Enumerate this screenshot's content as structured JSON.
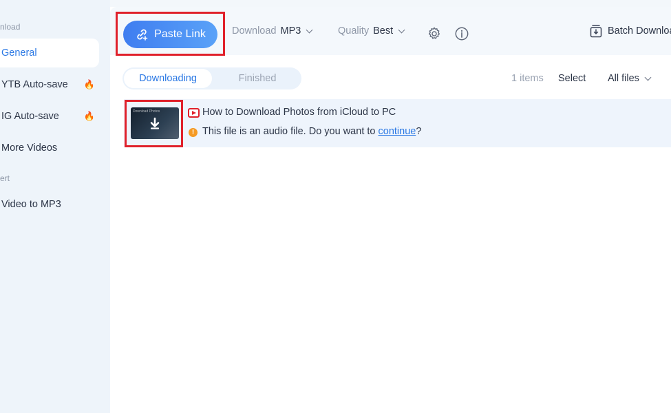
{
  "sidebar": {
    "section_download": "nload",
    "items": [
      {
        "label": "General",
        "active": true
      },
      {
        "label": "YTB Auto-save",
        "hot": true
      },
      {
        "label": "IG Auto-save",
        "hot": true
      },
      {
        "label": "More Videos"
      }
    ],
    "section_convert": "ert",
    "convert_items": [
      {
        "label": "Video to MP3"
      }
    ],
    "hot_icon": "🔥"
  },
  "toolbar": {
    "paste_label": "Paste Link",
    "download_label": "Download",
    "download_value": "MP3",
    "quality_label": "Quality",
    "quality_value": "Best",
    "batch_label": "Batch Download"
  },
  "tabs": {
    "downloading": "Downloading",
    "finished": "Finished"
  },
  "list_meta": {
    "items_count": "1 items",
    "select_label": "Select",
    "filter_label": "All files"
  },
  "rows": [
    {
      "title": "How to Download Photos from iCloud to PC",
      "message_prefix": "This file is an audio file. Do you want to ",
      "message_link": "continue",
      "message_suffix": "?",
      "thumb_text": "Download Photos",
      "warning_glyph": "!"
    }
  ],
  "colors": {
    "accent": "#2a78e4",
    "highlight": "#e0212b",
    "warning": "#f59a23"
  }
}
